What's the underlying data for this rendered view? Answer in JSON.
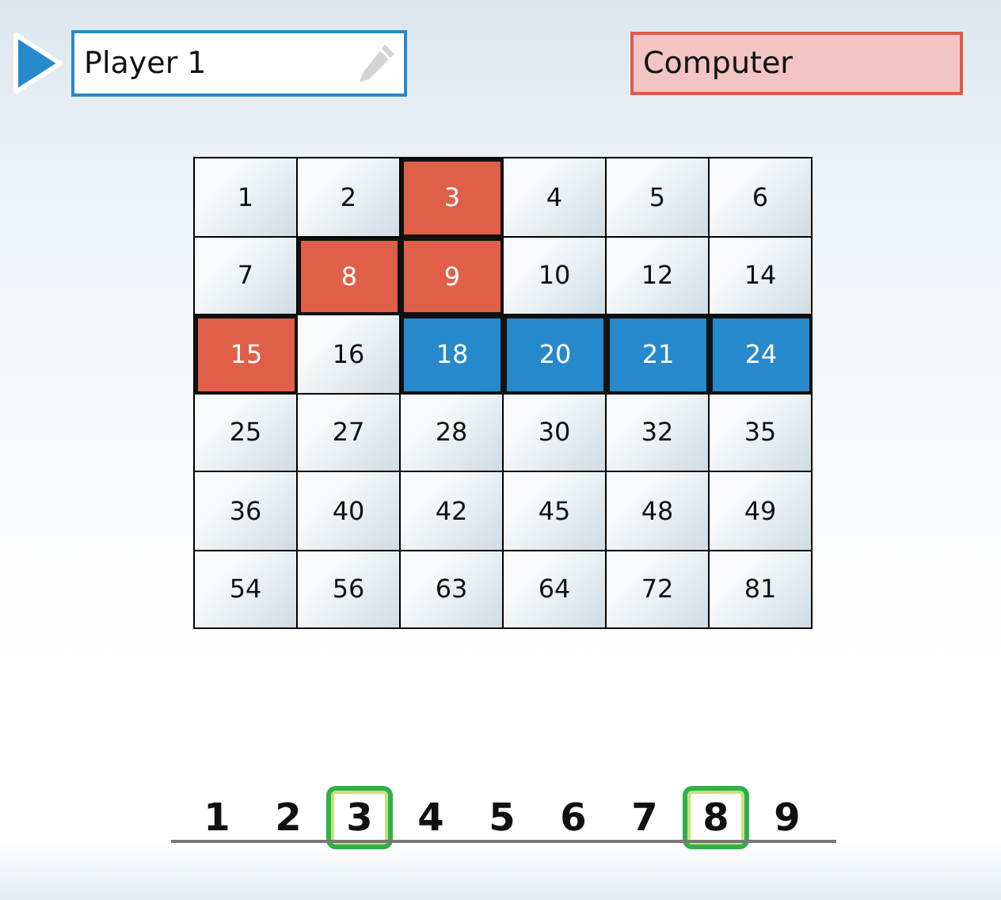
{
  "players": [
    {
      "kind": "human",
      "name": "Player 1",
      "active": true
    },
    {
      "kind": "computer",
      "name": "Computer",
      "active": false
    }
  ],
  "board": {
    "rows": [
      [
        {
          "value": "1",
          "kind": "open"
        },
        {
          "value": "2",
          "kind": "open"
        },
        {
          "value": "3",
          "kind": "computer"
        },
        {
          "value": "4",
          "kind": "open"
        },
        {
          "value": "5",
          "kind": "open"
        },
        {
          "value": "6",
          "kind": "open"
        }
      ],
      [
        {
          "value": "7",
          "kind": "open"
        },
        {
          "value": "8",
          "kind": "computer"
        },
        {
          "value": "9",
          "kind": "computer"
        },
        {
          "value": "10",
          "kind": "open"
        },
        {
          "value": "12",
          "kind": "open"
        },
        {
          "value": "14",
          "kind": "open"
        }
      ],
      [
        {
          "value": "15",
          "kind": "computer"
        },
        {
          "value": "16",
          "kind": "open"
        },
        {
          "value": "18",
          "kind": "human"
        },
        {
          "value": "20",
          "kind": "human"
        },
        {
          "value": "21",
          "kind": "human"
        },
        {
          "value": "24",
          "kind": "human"
        }
      ],
      [
        {
          "value": "25",
          "kind": "open"
        },
        {
          "value": "27",
          "kind": "open"
        },
        {
          "value": "28",
          "kind": "open"
        },
        {
          "value": "30",
          "kind": "open"
        },
        {
          "value": "32",
          "kind": "open"
        },
        {
          "value": "35",
          "kind": "open"
        }
      ],
      [
        {
          "value": "36",
          "kind": "open"
        },
        {
          "value": "40",
          "kind": "open"
        },
        {
          "value": "42",
          "kind": "open"
        },
        {
          "value": "45",
          "kind": "open"
        },
        {
          "value": "48",
          "kind": "open"
        },
        {
          "value": "49",
          "kind": "open"
        }
      ],
      [
        {
          "value": "54",
          "kind": "open"
        },
        {
          "value": "56",
          "kind": "open"
        },
        {
          "value": "63",
          "kind": "open"
        },
        {
          "value": "64",
          "kind": "open"
        },
        {
          "value": "72",
          "kind": "open"
        },
        {
          "value": "81",
          "kind": "open"
        }
      ]
    ]
  },
  "factors": [
    {
      "label": "1",
      "selected": false
    },
    {
      "label": "2",
      "selected": false
    },
    {
      "label": "3",
      "selected": true
    },
    {
      "label": "4",
      "selected": false
    },
    {
      "label": "5",
      "selected": false
    },
    {
      "label": "6",
      "selected": false
    },
    {
      "label": "7",
      "selected": false
    },
    {
      "label": "8",
      "selected": true
    },
    {
      "label": "9",
      "selected": false
    }
  ]
}
